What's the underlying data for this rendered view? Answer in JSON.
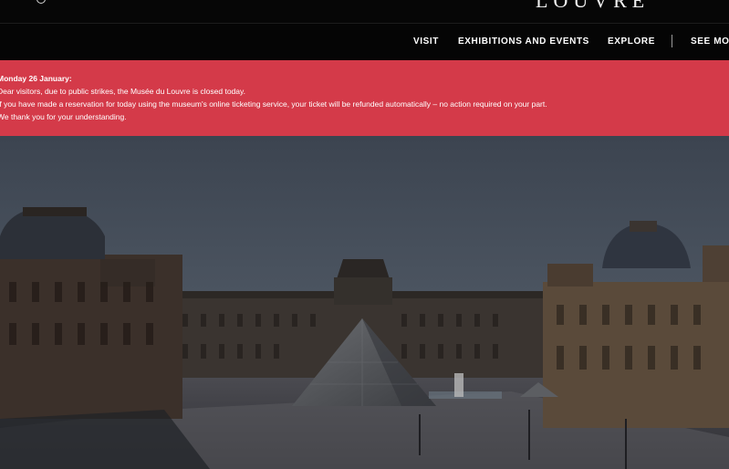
{
  "header": {
    "logo_text": "LOUVRE"
  },
  "nav": {
    "items": [
      {
        "label": "VISIT"
      },
      {
        "label": "EXHIBITIONS AND EVENTS"
      },
      {
        "label": "EXPLORE"
      },
      {
        "label": "SEE MO"
      }
    ]
  },
  "alert": {
    "title": "Monday 26 January:",
    "lines": [
      "Dear visitors, due to public strikes, the Musée du Louvre is closed today.",
      "If you have made a reservation for today using the museum's online ticketing service, your ticket will be refunded automatically – no action required on your part.",
      "We thank you for your understanding."
    ],
    "background_color": "#d43a49"
  },
  "hero": {
    "icons": [
      "user-icon"
    ]
  }
}
